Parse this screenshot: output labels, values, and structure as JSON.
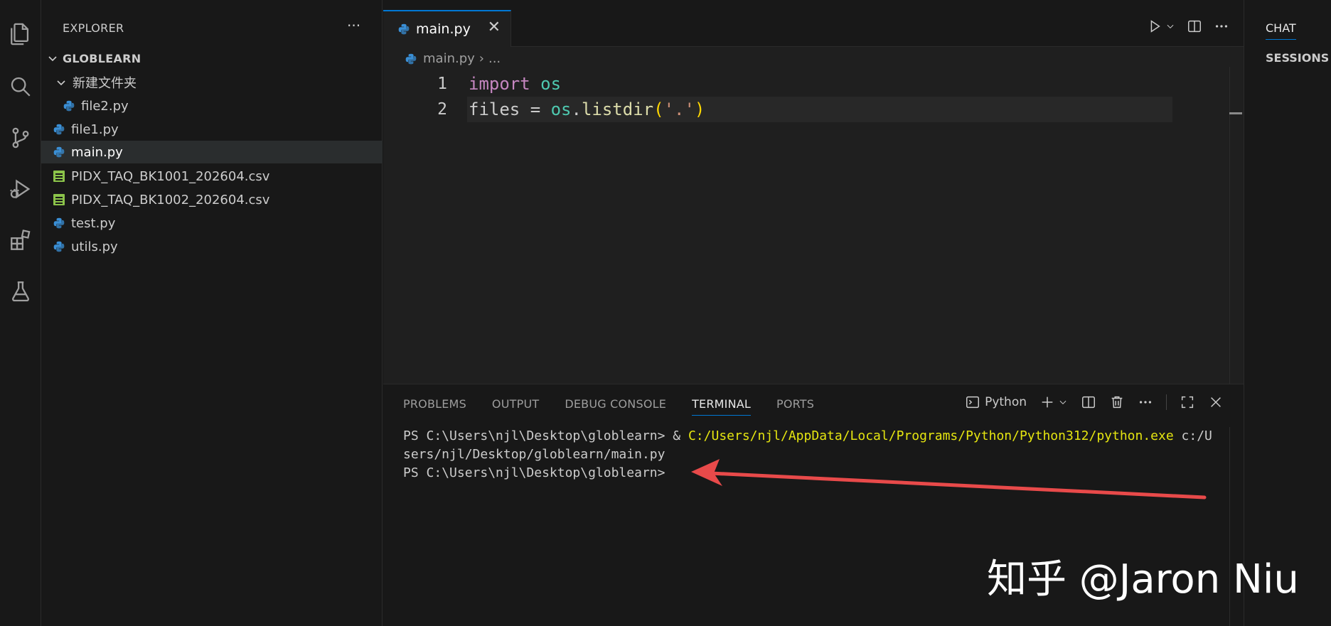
{
  "activity_bar": {
    "icons": [
      "files-icon",
      "search-icon",
      "source-control-icon",
      "run-debug-icon",
      "extensions-icon",
      "testing-icon"
    ]
  },
  "sidebar": {
    "title": "EXPLORER",
    "more": "···",
    "root": "GLOBLEARN",
    "items": [
      {
        "label": "新建文件夹",
        "type": "folder"
      },
      {
        "label": "file2.py",
        "type": "python"
      },
      {
        "label": "file1.py",
        "type": "python"
      },
      {
        "label": "main.py",
        "type": "python",
        "active": true
      },
      {
        "label": "PIDX_TAQ_BK1001_202604.csv",
        "type": "csv"
      },
      {
        "label": "PIDX_TAQ_BK1002_202604.csv",
        "type": "csv"
      },
      {
        "label": "test.py",
        "type": "python"
      },
      {
        "label": "utils.py",
        "type": "python"
      }
    ]
  },
  "editor": {
    "tab_label": "main.py",
    "tab_close": "✕",
    "breadcrumb_file": "main.py",
    "breadcrumb_rest": "...",
    "lines": [
      {
        "num": "1",
        "tokens": [
          [
            "kw",
            "import"
          ],
          [
            "plain",
            " "
          ],
          [
            "mod",
            "os"
          ]
        ]
      },
      {
        "num": "2",
        "tokens": [
          [
            "plain",
            "files = "
          ],
          [
            "mod",
            "os"
          ],
          [
            "plain",
            "."
          ],
          [
            "fn",
            "listdir"
          ],
          [
            "par",
            "("
          ],
          [
            "str",
            "'.'"
          ],
          [
            "par",
            ")"
          ]
        ]
      }
    ]
  },
  "panel": {
    "tabs": [
      "PROBLEMS",
      "OUTPUT",
      "DEBUG CONSOLE",
      "TERMINAL",
      "PORTS"
    ],
    "active_tab": "TERMINAL",
    "shell_label": "Python",
    "terminal": {
      "line1_prompt": "PS C:\\Users\\njl\\Desktop\\globlearn> & ",
      "line1_exe": "C:/Users/njl/AppData/Local/Programs/Python/Python312/python.exe",
      "line1_arg": " c:/U",
      "line2": "sers/njl/Desktop/globlearn/main.py",
      "line3": "PS C:\\Users\\njl\\Desktop\\globlearn>"
    }
  },
  "chat": {
    "tab": "CHAT",
    "sessions": "SESSIONS"
  },
  "overlay": {
    "watermark": "知乎 @Jaron Niu",
    "arrow_color": "#e84a4a"
  }
}
